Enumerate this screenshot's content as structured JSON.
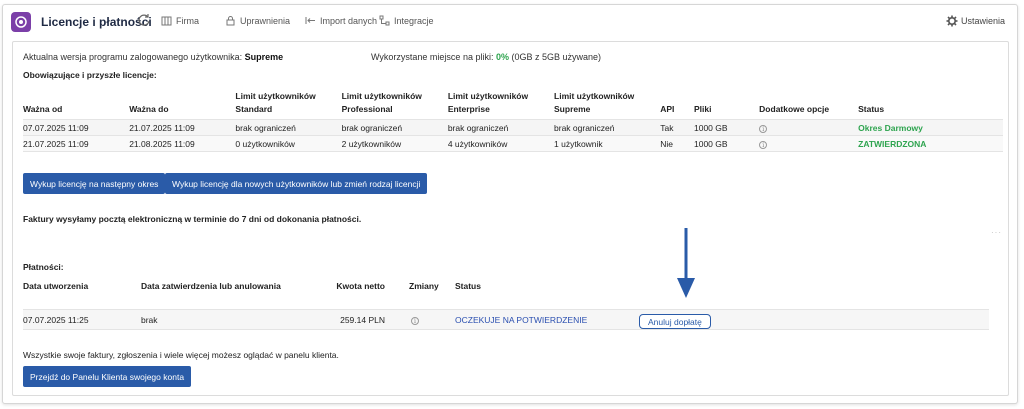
{
  "header": {
    "title": "Licencje i płatności",
    "nav": [
      {
        "label": "Firma",
        "icon": "building-icon"
      },
      {
        "label": "Uprawnienia",
        "icon": "lock-icon"
      },
      {
        "label": "Import danych",
        "icon": "import-icon"
      },
      {
        "label": "Integracje",
        "icon": "integration-icon"
      }
    ],
    "settings": "Ustawienia"
  },
  "info": {
    "version_prefix": "Aktualna wersja programu zalogowanego użytkownika: ",
    "version_value": "Supreme",
    "storage_prefix": "Wykorzystane miejsce na pliki: ",
    "storage_pct": "0%",
    "storage_suffix": " (0GB z 5GB używane)"
  },
  "licenses": {
    "title": "Obowiązujące i przyszłe licencje:",
    "columns": [
      "Ważna od",
      "Ważna do",
      "Limit użytkowników Standard",
      "Limit użytkowników Professional",
      "Limit użytkowników Enterprise",
      "Limit użytkowników Supreme",
      "API",
      "Pliki",
      "Dodatkowe opcje",
      "Status"
    ],
    "rows": [
      {
        "from": "07.07.2025 11:09",
        "to": "21.07.2025 11:09",
        "standard": "brak ograniczeń",
        "professional": "brak ograniczeń",
        "enterprise": "brak ograniczeń",
        "supreme": "brak ograniczeń",
        "api": "Tak",
        "files": "1000 GB",
        "status": "Okres Darmowy"
      },
      {
        "from": "21.07.2025 11:09",
        "to": "21.08.2025 11:09",
        "standard": "0 użytkowników",
        "professional": "2 użytkowników",
        "enterprise": "4 użytkowników",
        "supreme": "1 użytkownik",
        "api": "Nie",
        "files": "1000 GB",
        "status": "ZATWIERDZONA"
      }
    ],
    "btn_next": "Wykup licencję na następny okres",
    "btn_new": "Wykup licencję dla nowych użytkowników lub zmień rodzaj licencji"
  },
  "invoices_note": "Faktury wysyłamy pocztą elektroniczną w terminie do 7 dni od dokonania płatności.",
  "payments": {
    "title": "Płatności:",
    "columns": [
      "Data utworzenia",
      "Data zatwierdzenia lub anulowania",
      "Kwota netto",
      "Zmiany",
      "Status"
    ],
    "rows": [
      {
        "created": "07.07.2025 11:25",
        "approved": "brak",
        "amount": "259.14 PLN",
        "status": "OCZEKUJE NA POTWIERDZENIE",
        "action": "Anuluj dopłatę"
      }
    ]
  },
  "footer": {
    "note": "Wszystkie swoje faktury, zgłoszenia i wiele więcej możesz oglądać w panelu klienta.",
    "btn_panel": "Przejdź do Panelu Klienta swojego konta"
  },
  "colors": {
    "accent": "#2a5ba8",
    "green": "#2ea44f",
    "brand": "#7b3fa8"
  }
}
